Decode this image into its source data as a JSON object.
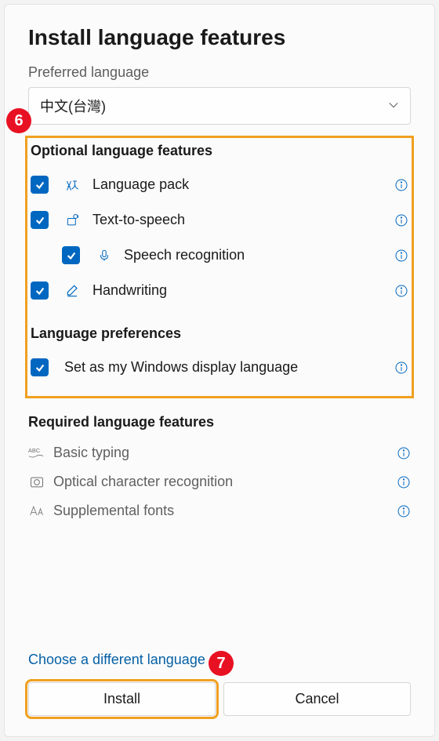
{
  "title": "Install language features",
  "preferred_label": "Preferred language",
  "dropdown": {
    "value": "中文(台灣)"
  },
  "optional": {
    "title": "Optional language features",
    "items": [
      {
        "label": "Language pack",
        "icon": "language-icon"
      },
      {
        "label": "Text-to-speech",
        "icon": "tts-icon"
      },
      {
        "label": "Speech recognition",
        "icon": "mic-icon",
        "indent": true
      },
      {
        "label": "Handwriting",
        "icon": "handwriting-icon"
      }
    ]
  },
  "preferences": {
    "title": "Language preferences",
    "items": [
      {
        "label": "Set as my Windows display language"
      }
    ]
  },
  "required": {
    "title": "Required language features",
    "items": [
      {
        "label": "Basic typing",
        "icon": "abc-icon"
      },
      {
        "label": "Optical character recognition",
        "icon": "ocr-icon"
      },
      {
        "label": "Supplemental fonts",
        "icon": "font-icon"
      }
    ]
  },
  "footer": {
    "link": "Choose a different language",
    "install": "Install",
    "cancel": "Cancel"
  },
  "callouts": {
    "six": "6",
    "seven": "7"
  }
}
